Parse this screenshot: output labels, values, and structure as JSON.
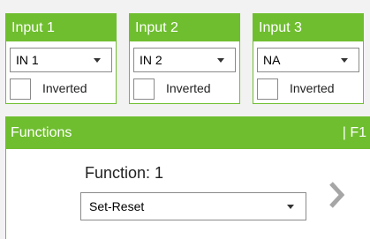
{
  "colors": {
    "accent": "#6fbe2f",
    "arrow": "#a6a6a6"
  },
  "inputs": [
    {
      "title": "Input 1",
      "selected": "IN 1",
      "inverted_label": "Inverted",
      "inverted": false
    },
    {
      "title": "Input 2",
      "selected": "IN 2",
      "inverted_label": "Inverted",
      "inverted": false
    },
    {
      "title": "Input 3",
      "selected": "NA",
      "inverted_label": "Inverted",
      "inverted": false
    }
  ],
  "functions": {
    "header": "Functions",
    "code": "| F1",
    "title": "Function: 1",
    "selected": "Set-Reset",
    "next_icon": "chevron-right-icon"
  }
}
